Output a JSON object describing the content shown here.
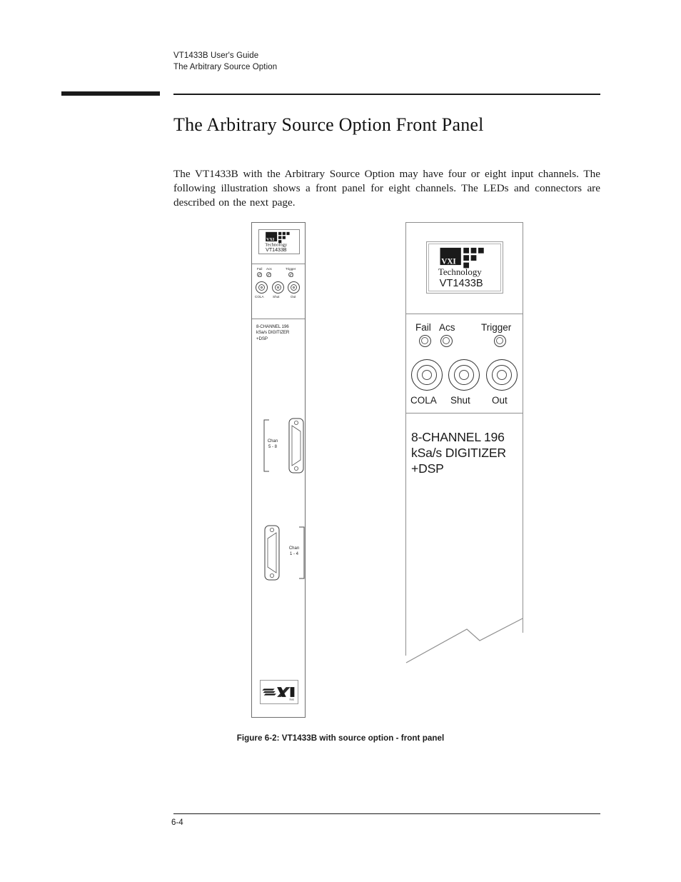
{
  "header": {
    "line1": "VT1433B User's Guide",
    "line2": "The Arbitrary Source Option"
  },
  "section": {
    "title": "The Arbitrary Source Option Front Panel"
  },
  "body": {
    "paragraph": "The VT1433B with the Arbitrary Source Option may have four or eight input channels.  The following illustration shows a front panel for eight channels.  The LEDs and connectors are described on the next page."
  },
  "figure": {
    "caption": "Figure 6-2: VT1433B with source option - front panel",
    "small_panel": {
      "name": "full-front-panel-view",
      "logo": {
        "brand_line1": "VXI",
        "brand_line2": "Technology",
        "model": "VT1433B"
      },
      "leds": [
        {
          "label": "Fail"
        },
        {
          "label": "Acs"
        },
        {
          "label": "Trigger"
        }
      ],
      "connectors": [
        {
          "label": "COLA"
        },
        {
          "label": "Shut"
        },
        {
          "label": "Out"
        }
      ],
      "description_lines": [
        "8-CHANNEL 196",
        "kSa/s DIGITIZER",
        "+DSP"
      ],
      "channel_blocks": [
        {
          "label_line1": "Chan",
          "label_line2": "5 - 8"
        },
        {
          "label_line1": "Chan",
          "label_line2": "1 - 4"
        }
      ],
      "bus_logo": "VXIbus"
    },
    "large_panel": {
      "name": "front-panel-detail-view",
      "logo": {
        "brand_line1": "VXI",
        "brand_line2": "Technology",
        "model": "VT1433B"
      },
      "leds": [
        {
          "label": "Fail"
        },
        {
          "label": "Acs"
        },
        {
          "label": "Trigger"
        }
      ],
      "connectors": [
        {
          "label": "COLA"
        },
        {
          "label": "Shut"
        },
        {
          "label": "Out"
        }
      ],
      "description_lines": [
        "8-CHANNEL 196",
        "kSa/s DIGITIZER",
        "+DSP"
      ]
    }
  },
  "footer": {
    "page_number": "6-4"
  },
  "colors": {
    "ink": "#1a1a1a",
    "rule": "#1a1a1a",
    "panel_line": "#8f8f8f",
    "logo_fill": "#1a1a1a"
  }
}
